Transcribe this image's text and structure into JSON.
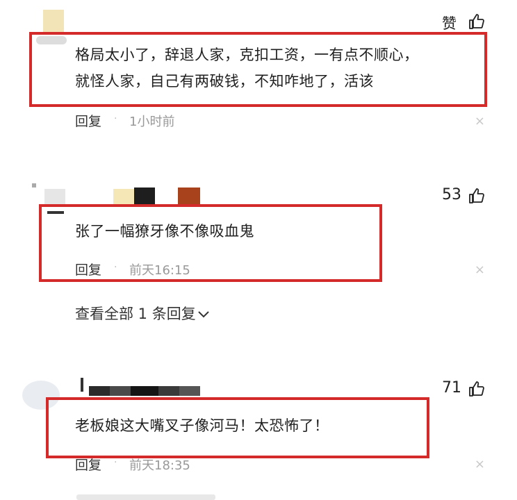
{
  "comments": [
    {
      "like_label": "赞",
      "text_line1": "格局太小了，辞退人家，克扣工资，一有点不顺心，",
      "text_line2": "就怪人家，自己有两破钱，不知咋地了，活该",
      "reply_label": "回复",
      "separator": "·",
      "time": "1小时前",
      "close": "×"
    },
    {
      "like_count": "53",
      "text_line1": "张了一幅獠牙像不像吸血鬼",
      "reply_label": "回复",
      "separator": "·",
      "time": "前天16:15",
      "close": "×",
      "view_replies": "查看全部 1 条回复"
    },
    {
      "like_count": "71",
      "text_line1": "老板娘这大嘴叉子像河马！太恐怖了！",
      "reply_label": "回复",
      "separator": "·",
      "time": "前天18:35",
      "close": "×"
    }
  ],
  "colors": {
    "highlight_box": "#d42a2a",
    "time_text": "#999999",
    "close_icon": "#c8c8c8"
  },
  "icons": [
    "thumbs-up-icon",
    "chevron-down-icon",
    "close-icon"
  ]
}
